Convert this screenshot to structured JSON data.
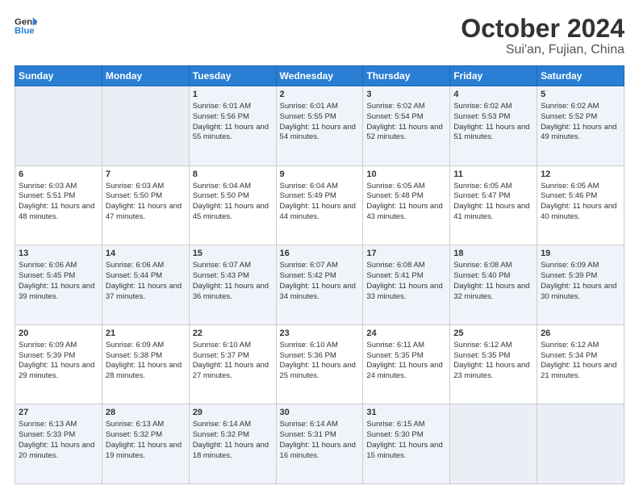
{
  "logo": {
    "line1": "General",
    "line2": "Blue"
  },
  "title": "October 2024",
  "subtitle": "Sui'an, Fujian, China",
  "days_of_week": [
    "Sunday",
    "Monday",
    "Tuesday",
    "Wednesday",
    "Thursday",
    "Friday",
    "Saturday"
  ],
  "weeks": [
    [
      {
        "day": "",
        "sunrise": "",
        "sunset": "",
        "daylight": ""
      },
      {
        "day": "",
        "sunrise": "",
        "sunset": "",
        "daylight": ""
      },
      {
        "day": "1",
        "sunrise": "Sunrise: 6:01 AM",
        "sunset": "Sunset: 5:56 PM",
        "daylight": "Daylight: 11 hours and 55 minutes."
      },
      {
        "day": "2",
        "sunrise": "Sunrise: 6:01 AM",
        "sunset": "Sunset: 5:55 PM",
        "daylight": "Daylight: 11 hours and 54 minutes."
      },
      {
        "day": "3",
        "sunrise": "Sunrise: 6:02 AM",
        "sunset": "Sunset: 5:54 PM",
        "daylight": "Daylight: 11 hours and 52 minutes."
      },
      {
        "day": "4",
        "sunrise": "Sunrise: 6:02 AM",
        "sunset": "Sunset: 5:53 PM",
        "daylight": "Daylight: 11 hours and 51 minutes."
      },
      {
        "day": "5",
        "sunrise": "Sunrise: 6:02 AM",
        "sunset": "Sunset: 5:52 PM",
        "daylight": "Daylight: 11 hours and 49 minutes."
      }
    ],
    [
      {
        "day": "6",
        "sunrise": "Sunrise: 6:03 AM",
        "sunset": "Sunset: 5:51 PM",
        "daylight": "Daylight: 11 hours and 48 minutes."
      },
      {
        "day": "7",
        "sunrise": "Sunrise: 6:03 AM",
        "sunset": "Sunset: 5:50 PM",
        "daylight": "Daylight: 11 hours and 47 minutes."
      },
      {
        "day": "8",
        "sunrise": "Sunrise: 6:04 AM",
        "sunset": "Sunset: 5:50 PM",
        "daylight": "Daylight: 11 hours and 45 minutes."
      },
      {
        "day": "9",
        "sunrise": "Sunrise: 6:04 AM",
        "sunset": "Sunset: 5:49 PM",
        "daylight": "Daylight: 11 hours and 44 minutes."
      },
      {
        "day": "10",
        "sunrise": "Sunrise: 6:05 AM",
        "sunset": "Sunset: 5:48 PM",
        "daylight": "Daylight: 11 hours and 43 minutes."
      },
      {
        "day": "11",
        "sunrise": "Sunrise: 6:05 AM",
        "sunset": "Sunset: 5:47 PM",
        "daylight": "Daylight: 11 hours and 41 minutes."
      },
      {
        "day": "12",
        "sunrise": "Sunrise: 6:05 AM",
        "sunset": "Sunset: 5:46 PM",
        "daylight": "Daylight: 11 hours and 40 minutes."
      }
    ],
    [
      {
        "day": "13",
        "sunrise": "Sunrise: 6:06 AM",
        "sunset": "Sunset: 5:45 PM",
        "daylight": "Daylight: 11 hours and 39 minutes."
      },
      {
        "day": "14",
        "sunrise": "Sunrise: 6:06 AM",
        "sunset": "Sunset: 5:44 PM",
        "daylight": "Daylight: 11 hours and 37 minutes."
      },
      {
        "day": "15",
        "sunrise": "Sunrise: 6:07 AM",
        "sunset": "Sunset: 5:43 PM",
        "daylight": "Daylight: 11 hours and 36 minutes."
      },
      {
        "day": "16",
        "sunrise": "Sunrise: 6:07 AM",
        "sunset": "Sunset: 5:42 PM",
        "daylight": "Daylight: 11 hours and 34 minutes."
      },
      {
        "day": "17",
        "sunrise": "Sunrise: 6:08 AM",
        "sunset": "Sunset: 5:41 PM",
        "daylight": "Daylight: 11 hours and 33 minutes."
      },
      {
        "day": "18",
        "sunrise": "Sunrise: 6:08 AM",
        "sunset": "Sunset: 5:40 PM",
        "daylight": "Daylight: 11 hours and 32 minutes."
      },
      {
        "day": "19",
        "sunrise": "Sunrise: 6:09 AM",
        "sunset": "Sunset: 5:39 PM",
        "daylight": "Daylight: 11 hours and 30 minutes."
      }
    ],
    [
      {
        "day": "20",
        "sunrise": "Sunrise: 6:09 AM",
        "sunset": "Sunset: 5:39 PM",
        "daylight": "Daylight: 11 hours and 29 minutes."
      },
      {
        "day": "21",
        "sunrise": "Sunrise: 6:09 AM",
        "sunset": "Sunset: 5:38 PM",
        "daylight": "Daylight: 11 hours and 28 minutes."
      },
      {
        "day": "22",
        "sunrise": "Sunrise: 6:10 AM",
        "sunset": "Sunset: 5:37 PM",
        "daylight": "Daylight: 11 hours and 27 minutes."
      },
      {
        "day": "23",
        "sunrise": "Sunrise: 6:10 AM",
        "sunset": "Sunset: 5:36 PM",
        "daylight": "Daylight: 11 hours and 25 minutes."
      },
      {
        "day": "24",
        "sunrise": "Sunrise: 6:11 AM",
        "sunset": "Sunset: 5:35 PM",
        "daylight": "Daylight: 11 hours and 24 minutes."
      },
      {
        "day": "25",
        "sunrise": "Sunrise: 6:12 AM",
        "sunset": "Sunset: 5:35 PM",
        "daylight": "Daylight: 11 hours and 23 minutes."
      },
      {
        "day": "26",
        "sunrise": "Sunrise: 6:12 AM",
        "sunset": "Sunset: 5:34 PM",
        "daylight": "Daylight: 11 hours and 21 minutes."
      }
    ],
    [
      {
        "day": "27",
        "sunrise": "Sunrise: 6:13 AM",
        "sunset": "Sunset: 5:33 PM",
        "daylight": "Daylight: 11 hours and 20 minutes."
      },
      {
        "day": "28",
        "sunrise": "Sunrise: 6:13 AM",
        "sunset": "Sunset: 5:32 PM",
        "daylight": "Daylight: 11 hours and 19 minutes."
      },
      {
        "day": "29",
        "sunrise": "Sunrise: 6:14 AM",
        "sunset": "Sunset: 5:32 PM",
        "daylight": "Daylight: 11 hours and 18 minutes."
      },
      {
        "day": "30",
        "sunrise": "Sunrise: 6:14 AM",
        "sunset": "Sunset: 5:31 PM",
        "daylight": "Daylight: 11 hours and 16 minutes."
      },
      {
        "day": "31",
        "sunrise": "Sunrise: 6:15 AM",
        "sunset": "Sunset: 5:30 PM",
        "daylight": "Daylight: 11 hours and 15 minutes."
      },
      {
        "day": "",
        "sunrise": "",
        "sunset": "",
        "daylight": ""
      },
      {
        "day": "",
        "sunrise": "",
        "sunset": "",
        "daylight": ""
      }
    ]
  ]
}
